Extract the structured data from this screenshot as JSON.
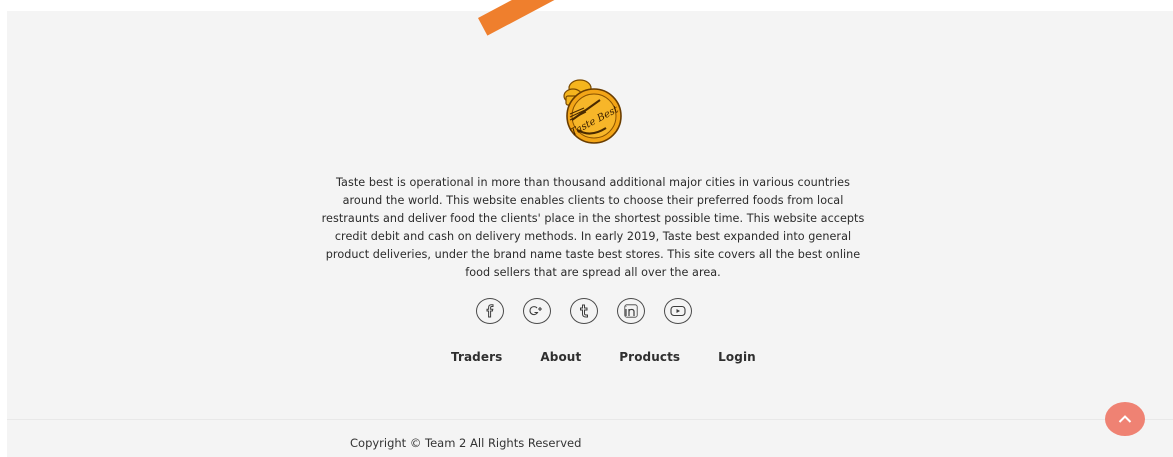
{
  "brand": {
    "logo_text": "Taste Best",
    "colors": {
      "accent": "#ef7f2d",
      "logo_gold": "#f2a516",
      "back_to_top": "#ef8273"
    }
  },
  "footer": {
    "description": "Taste best is operational in more than thousand additional major cities in various countries around the world. This website enables clients to choose their preferred foods from local restraunts and deliver food the clients' place in the shortest possible time. This website accepts credit debit and cash on delivery methods. In early 2019, Taste best expanded into general product deliveries, under the brand name taste best stores. This site covers all the best online food sellers that are spread all over the area.",
    "social": [
      {
        "icon": "facebook-icon"
      },
      {
        "icon": "google-plus-icon"
      },
      {
        "icon": "tumblr-icon"
      },
      {
        "icon": "linkedin-icon"
      },
      {
        "icon": "youtube-icon"
      }
    ],
    "nav": [
      {
        "label": "Traders"
      },
      {
        "label": "About"
      },
      {
        "label": "Products"
      },
      {
        "label": "Login"
      }
    ],
    "copyright": "Copyright © Team 2 All Rights Reserved"
  },
  "back_to_top": {
    "icon": "chevron-up-icon"
  }
}
